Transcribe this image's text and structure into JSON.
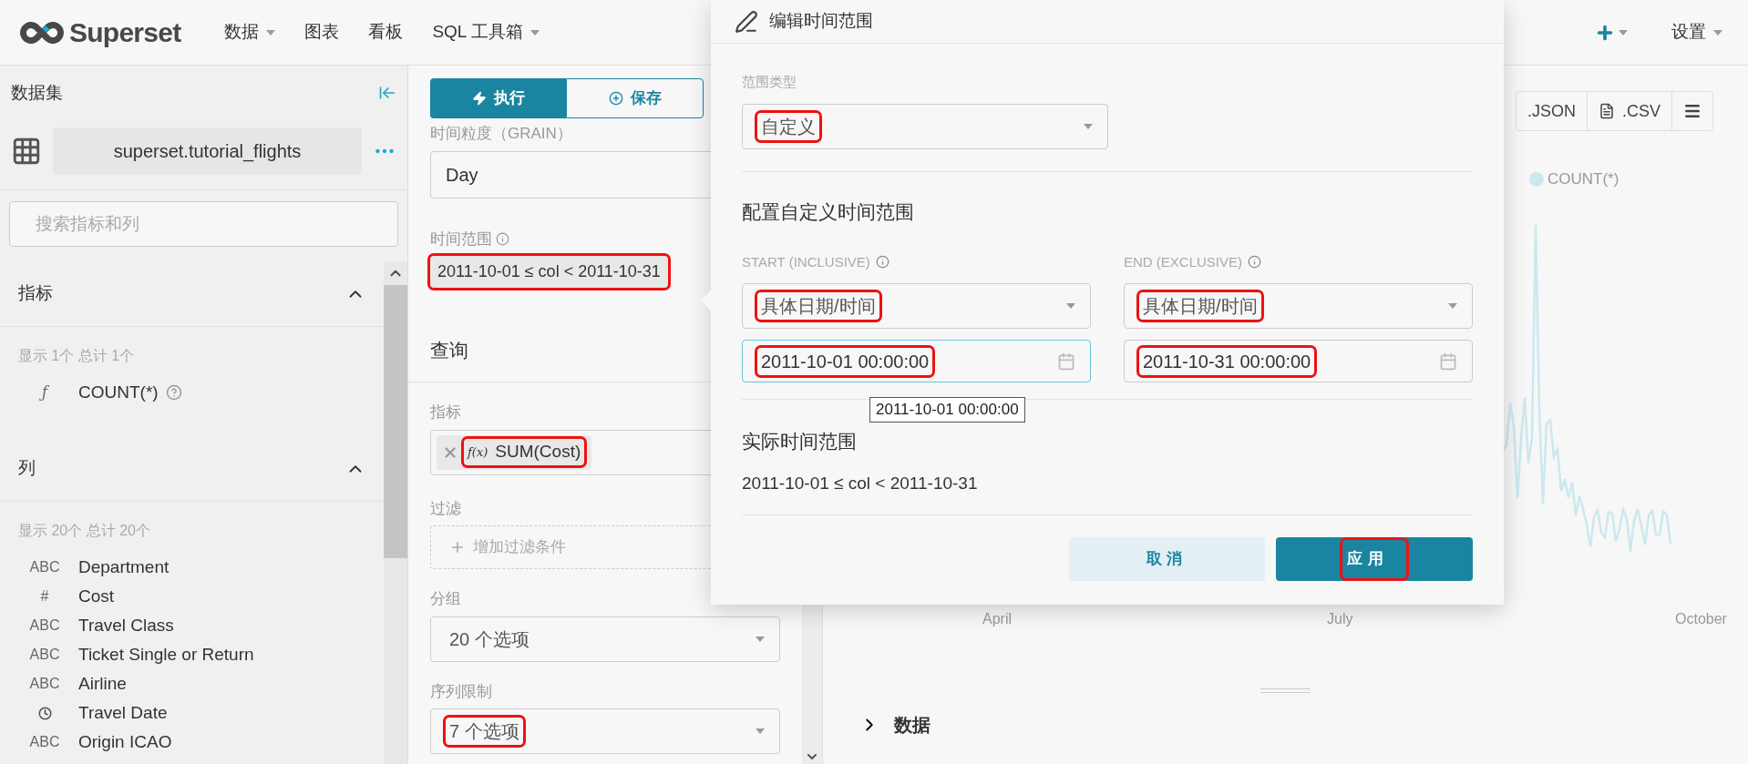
{
  "navbar": {
    "logo_text": "Superset",
    "menu": [
      {
        "label": "数据",
        "dropdown": true
      },
      {
        "label": "图表",
        "dropdown": false
      },
      {
        "label": "看板",
        "dropdown": false
      },
      {
        "label": "SQL 工具箱",
        "dropdown": true
      }
    ],
    "settings_label": "设置"
  },
  "sidebar": {
    "title": "数据集",
    "dataset": "superset.tutorial_flights",
    "search": {
      "placeholder": "搜索指标和列"
    },
    "sections": [
      {
        "title": "指标",
        "expanded": true,
        "summary": "显示 1个 总计 1个",
        "items": [
          {
            "kind": "text",
            "type_label": "ƒ",
            "name": "COUNT(*)",
            "help": true
          }
        ]
      },
      {
        "title": "列",
        "expanded": true,
        "summary": "显示 20个 总计 20个",
        "items": [
          {
            "kind": "text",
            "type_label": "ABC",
            "name": "Department",
            "help": false
          },
          {
            "kind": "text",
            "type_label": "#",
            "name": "Cost",
            "help": false
          },
          {
            "kind": "text",
            "type_label": "ABC",
            "name": "Travel Class",
            "help": false
          },
          {
            "kind": "text",
            "type_label": "ABC",
            "name": "Ticket Single or Return",
            "help": false
          },
          {
            "kind": "text",
            "type_label": "ABC",
            "name": "Airline",
            "help": false
          },
          {
            "kind": "time",
            "name": "Travel Date",
            "help": false
          },
          {
            "kind": "text",
            "type_label": "ABC",
            "name": "Origin ICAO",
            "help": false
          }
        ]
      }
    ]
  },
  "controls": {
    "run_label": "执行",
    "save_label": "保存",
    "grain": {
      "label": "时间粒度（GRAIN）",
      "value": "Day"
    },
    "time_range": {
      "label": "时间范围",
      "value": "2011-10-01 ≤ col < 2011-10-31",
      "highlighted": true
    },
    "query_title": "查询",
    "metrics": {
      "label": "指标",
      "items": [
        {
          "function_mark": "f(x)",
          "value": "SUM(Cost)",
          "highlighted": true
        }
      ]
    },
    "filters": {
      "label": "过滤",
      "placeholder": "增加过滤条件"
    },
    "groupby": {
      "label": "分组",
      "value": "20 个选项",
      "highlighted": false
    },
    "series_limit": {
      "label": "序列限制",
      "value": "7 个选项",
      "highlighted": true
    }
  },
  "chart": {
    "buttons": [
      {
        "kind": "json",
        "label": ".JSON"
      },
      {
        "kind": "csv",
        "label": ".CSV"
      }
    ],
    "legend": "COUNT(*)",
    "x_labels": [
      "April",
      "July",
      "October"
    ],
    "data_section": {
      "title": "数据",
      "expanded": false
    }
  },
  "time_popover": {
    "title": "编辑时间范围",
    "range_type": {
      "label": "范围类型",
      "value": "自定义",
      "highlighted": true
    },
    "section_title": "配置自定义时间范围",
    "bounds": [
      {
        "label": "START (INCLUSIVE)",
        "mode": "具体日期/时间",
        "mode_highlighted": true,
        "value": "2011-10-01 00:00:00",
        "value_highlighted": true,
        "focused": true
      },
      {
        "label": "END (EXCLUSIVE)",
        "mode": "具体日期/时间",
        "mode_highlighted": true,
        "value": "2011-10-31 00:00:00",
        "value_highlighted": true,
        "focused": false
      }
    ],
    "tooltip": "2011-10-01 00:00:00",
    "actual_title": "实际时间范围",
    "actual_value": "2011-10-01 ≤ col < 2011-10-31",
    "cancel_label": "取消",
    "apply_label": "应用",
    "apply_highlighted": true
  }
}
